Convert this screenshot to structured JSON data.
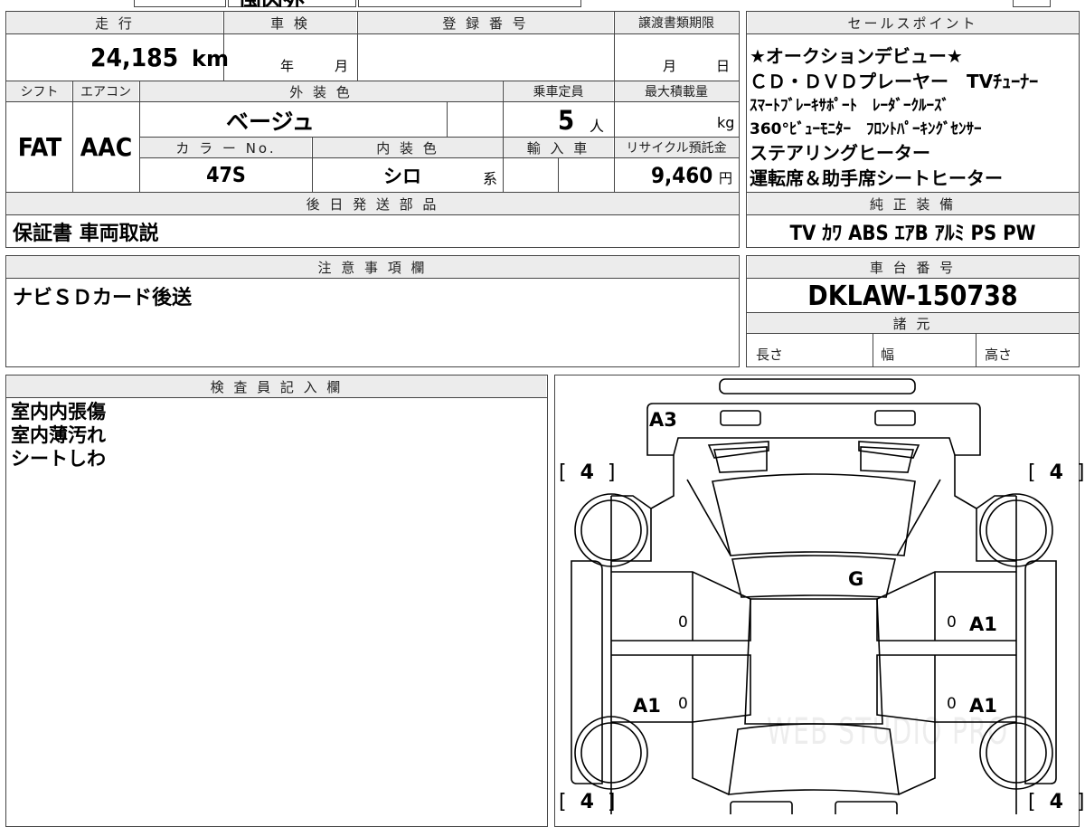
{
  "top_strip": {
    "text": "国内外"
  },
  "headers": {
    "mileage": "走 行",
    "inspection": "車 検",
    "registration": "登 録 番 号",
    "transfer_deadline": "譲渡書類期限",
    "sales_points": "セールスポイント",
    "shift": "シフト",
    "aircon": "エアコン",
    "exterior_color": "外 装 色",
    "capacity": "乗車定員",
    "max_load": "最大積載量",
    "color_no": "カ ラ ー No.",
    "interior_color": "内 装 色",
    "import": "輸 入 車",
    "recycle": "リサイクル預託金",
    "later_parts": "後 日 発 送 部 品",
    "genuine_equipment": "純 正 装 備",
    "notes": "注 意 事 項 欄",
    "chassis_no": "車 台 番 号",
    "specs": "諸 元",
    "inspector": "検 査 員 記 入 欄"
  },
  "vehicle": {
    "mileage": "24,185",
    "mileage_unit": "km",
    "inspection_year_unit": "年",
    "inspection_month_unit": "月",
    "transfer_month_unit": "月",
    "transfer_day_unit": "日",
    "shift": "FAT",
    "aircon": "AAC",
    "exterior_color": "ベージュ",
    "capacity": "5",
    "capacity_unit": "人",
    "max_load_unit": "kg",
    "color_no": "47S",
    "interior_color": "シロ",
    "interior_suffix": "系",
    "recycle_fee": "9,460",
    "recycle_unit": "円"
  },
  "sales_points": [
    "★オークションデビュー★",
    "ＣＤ・ＤＶＤプレーヤー　TVﾁｭｰﾅｰ",
    "ｽﾏｰﾄﾌﾞﾚｰｷｻﾎﾟｰﾄ　ﾚｰﾀﾞｰｸﾙｰｽﾞ",
    "360°ﾋﾞｭｰﾓﾆﾀｰ　ﾌﾛﾝﾄﾊﾟｰｷﾝｸﾞｾﾝｻｰ",
    "ステアリングヒーター",
    "運転席＆助手席シートヒーター"
  ],
  "later_parts": "保証書 車両取説",
  "genuine_equipment": "TV ｶﾜ ABS ｴｱB ｱﾙﾐ PS PW",
  "notes": "ナビＳＤカード後送",
  "chassis_no": "DKLAW-150738",
  "specs": {
    "length": "長さ",
    "width": "幅",
    "height": "高さ"
  },
  "inspector_notes": "室内内張傷\n室内薄汚れ\nシートしわ",
  "diagram": {
    "marks": {
      "rear": "A3",
      "glass": "G",
      "right_rear_door": "A1",
      "left_front_door": "A1",
      "right_front_door": "A1"
    },
    "zeros": [
      "0",
      "0",
      "0",
      "0"
    ],
    "tire_depth": "4",
    "tire_bracket_open": "[",
    "tire_bracket_close": "]",
    "watermark": "WEB STUDIO PRO"
  }
}
